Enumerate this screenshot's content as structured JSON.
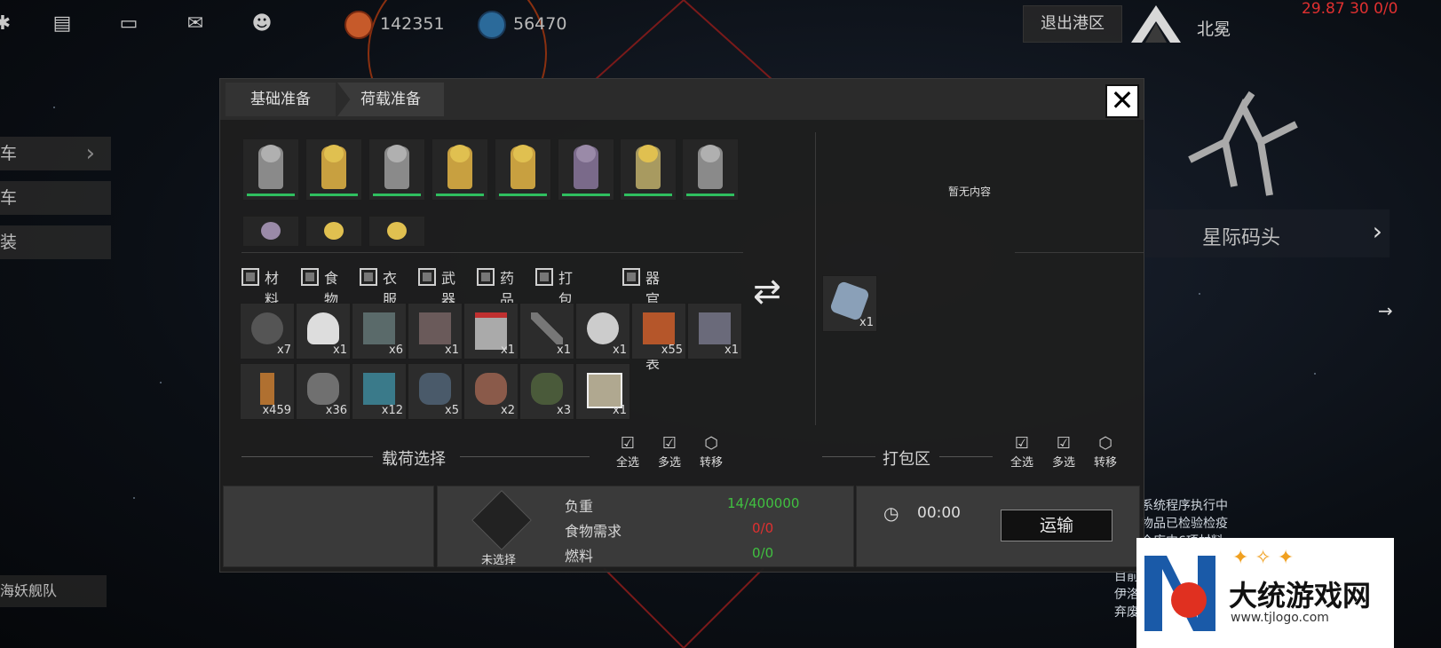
{
  "topbar": {
    "icons": [
      "gear-icon",
      "chat-icon",
      "message-icon",
      "mail-icon",
      "user-icon"
    ],
    "resource1_value": "142351",
    "resource2_value": "56470",
    "exit_label": "退出港区",
    "region_name": "北冕",
    "stats_text": "29.87 30 0/0"
  },
  "sidemenu": {
    "items": [
      "车",
      "车",
      "装"
    ],
    "fleet_label": "海妖舰队"
  },
  "right_panel": {
    "dock_title": "星际码头",
    "log_lines": [
      "系统程序执行中",
      "物品已检验检疫",
      "仓库中6项材料"
    ],
    "bottom_lines": [
      "目前",
      "伊洛",
      "弃废"
    ]
  },
  "dialog": {
    "tabs": [
      "基础准备",
      "荷载准备"
    ],
    "close_label": "✕",
    "empty_text": "暂无内容",
    "filters": [
      "材料",
      "食物",
      "衣服",
      "武器",
      "药品",
      "打包建筑",
      "器官道具表"
    ],
    "cargo_items": [
      {
        "name": "ore",
        "qty": "x7"
      },
      {
        "name": "helmet",
        "qty": "x1"
      },
      {
        "name": "device",
        "qty": "x6"
      },
      {
        "name": "boots",
        "qty": "x1"
      },
      {
        "name": "armor-legs",
        "qty": "x1"
      },
      {
        "name": "rifle",
        "qty": "x1"
      },
      {
        "name": "skull-helmet",
        "qty": "x1"
      },
      {
        "name": "wood-planks",
        "qty": "x55"
      },
      {
        "name": "machine",
        "qty": "x1"
      },
      {
        "name": "wood",
        "qty": "x459"
      },
      {
        "name": "steel",
        "qty": "x36"
      },
      {
        "name": "circuit",
        "qty": "x12"
      },
      {
        "name": "crystal-ore",
        "qty": "x5"
      },
      {
        "name": "copper-ore",
        "qty": "x2"
      },
      {
        "name": "moss-rock",
        "qty": "x3"
      },
      {
        "name": "fish",
        "qty": "x1"
      }
    ],
    "pack_items": [
      {
        "name": "core",
        "qty": "x1"
      }
    ],
    "cargo_section_label": "载荷选择",
    "pack_section_label": "打包区",
    "actions": {
      "select_all": "全选",
      "multi_select": "多选",
      "transfer": "转移"
    },
    "selection_label": "未选择",
    "stats": {
      "load_label": "负重",
      "load_value": "14/400000",
      "food_label": "食物需求",
      "food_value": "0/0",
      "fuel_label": "燃料",
      "fuel_value": "0/0"
    },
    "timer": "00:00",
    "transport_label": "运输"
  },
  "watermark": {
    "site_name": "大统游戏网",
    "url": "www.tjlogo.com"
  },
  "colors": {
    "green": "#2fbf5f",
    "red": "#e03030",
    "load_green": "#40c040"
  }
}
